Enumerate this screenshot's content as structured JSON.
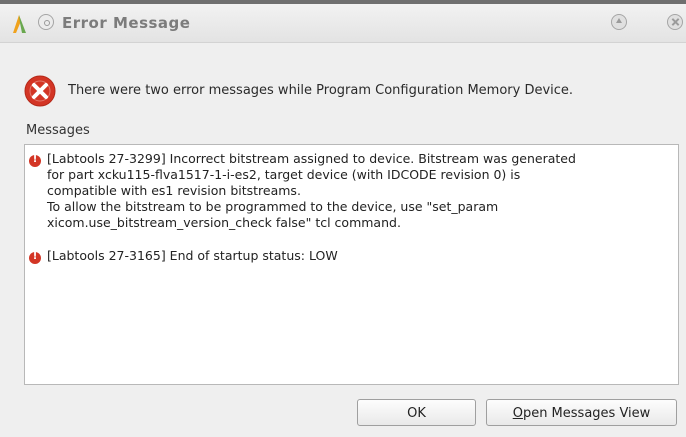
{
  "window": {
    "title": "Error Message"
  },
  "summary": {
    "text": "There were two error messages while Program Configuration Memory Device."
  },
  "messages_section": {
    "label": "Messages",
    "items": [
      {
        "lines": [
          "[Labtools 27-3299] Incorrect bitstream assigned to device. Bitstream was generated",
          "for part xcku115-flva1517-1-i-es2, target device (with IDCODE revision 0) is",
          "compatible with es1 revision bitstreams.",
          "To allow the bitstream to be programmed to the device, use \"set_param",
          "xicom.use_bitstream_version_check false\" tcl command."
        ]
      },
      {
        "lines": [
          "[Labtools 27-3165] End of startup status: LOW"
        ]
      }
    ]
  },
  "buttons": {
    "ok_label": "OK",
    "open_messages_mnemonic": "O",
    "open_messages_rest": "pen Messages View"
  },
  "icons": {
    "app": "vivado-logo-icon",
    "error_large": "error-circle-x-icon",
    "error_small": "error-bullet-icon"
  },
  "colors": {
    "error_red": "#d33525"
  }
}
